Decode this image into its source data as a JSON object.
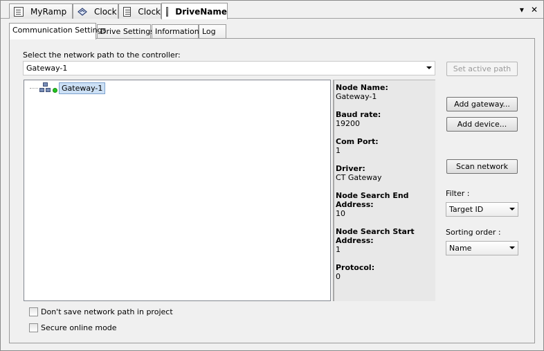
{
  "editor_tabs": [
    {
      "label": "MyRamp",
      "icon": "document-icon"
    },
    {
      "label": "Clock",
      "icon": "ramp-icon"
    },
    {
      "label": "Clock",
      "icon": "document-icon"
    },
    {
      "label": "DriveName",
      "icon": "drive-icon"
    }
  ],
  "window_controls": {
    "dropdown": "▾",
    "close": "✕"
  },
  "inner_tabs": [
    "Communication Settings",
    "Drive Settings",
    "Information",
    "Log"
  ],
  "main": {
    "select_label": "Select the network path to the controller:",
    "network_path_value": "Gateway-1",
    "tree_node": "Gateway-1"
  },
  "properties": [
    {
      "name": "Node Name:",
      "value": "Gateway-1"
    },
    {
      "name": "Baud rate:",
      "value": "19200"
    },
    {
      "name": "Com Port:",
      "value": "1"
    },
    {
      "name": "Driver:",
      "value": "CT Gateway"
    },
    {
      "name": "Node Search End Address:",
      "name_line1": "Node Search End",
      "name_line2": "Address:",
      "value": "10"
    },
    {
      "name": "Node Search Start Address:",
      "name_line1": "Node Search Start",
      "name_line2": "Address:",
      "value": "1"
    },
    {
      "name": "Protocol:",
      "value": "0"
    }
  ],
  "buttons": {
    "set_active_path": "Set active path",
    "add_gateway": "Add gateway...",
    "add_device": "Add device...",
    "scan_network": "Scan network"
  },
  "filter": {
    "label": "Filter :",
    "value": "Target ID"
  },
  "sorting": {
    "label": "Sorting order :",
    "value": "Name"
  },
  "checkboxes": [
    {
      "label": "Don't save network path in project",
      "checked": false
    },
    {
      "label": "Secure online mode",
      "checked": false
    }
  ],
  "colors": {
    "selection": "#cce0f5",
    "status_online": "#22c41e"
  }
}
